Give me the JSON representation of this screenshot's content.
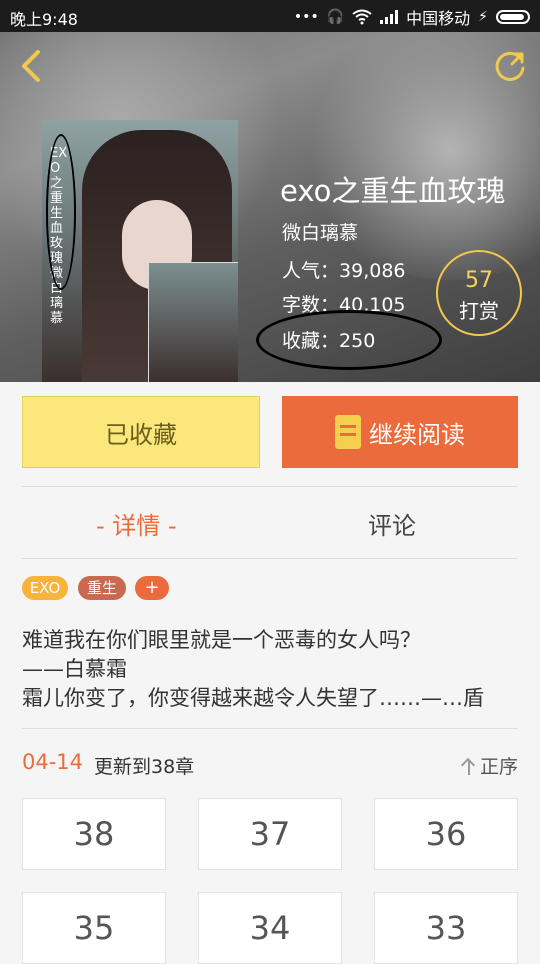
{
  "status_bar": {
    "time": "晚上9:48",
    "carrier": "中国移动",
    "dots": "•••"
  },
  "book": {
    "title": "exo之重生血玫瑰",
    "author": "微白璃慕",
    "popularity_label": "人气：",
    "popularity_value": "39,086",
    "words_label": "字数：",
    "words_value": "40,105",
    "favorites_label": "收藏：",
    "favorites_value": "250",
    "cover_text": "EXO之重生血玫瑰 微白璃慕"
  },
  "tip": {
    "count": "57",
    "label": "打赏"
  },
  "actions": {
    "collected_label": "已收藏",
    "continue_label": "继续阅读"
  },
  "tabs": {
    "details": "- 详情 -",
    "comments": "评论"
  },
  "tags": [
    "EXO",
    "重生",
    "+"
  ],
  "description": [
    "难道我在你们眼里就是一个恶毒的女人吗？",
    "——白慕霜",
    "霜儿你变了，你变得越来越令人失望了……—…盾"
  ],
  "update": {
    "date": "04-14",
    "text": "更新到38章",
    "sort_label": "正序"
  },
  "chapters": [
    "38",
    "37",
    "36",
    "35",
    "34",
    "33"
  ],
  "colors": {
    "accent": "#ec6b3c",
    "collected_bg": "#fbe77b",
    "tip_gold": "#f2c94c"
  }
}
